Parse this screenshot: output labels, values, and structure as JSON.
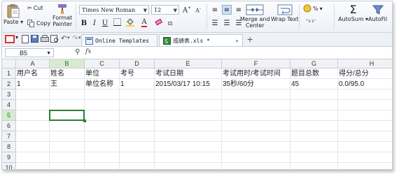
{
  "ribbon": {
    "paste": "Paste",
    "cut": "Cut",
    "copy": "Copy",
    "format_painter": [
      "Format",
      "Painter"
    ],
    "font_name": "Times New Roman",
    "font_size": "12",
    "merge_center": [
      "Merge and",
      "Center"
    ],
    "wrap_text": "Wrap Text",
    "percent": "%",
    "autosum": "AutoSum",
    "autofilter": "AutoFil"
  },
  "tabs": [
    {
      "label": "Online Templates",
      "active": false
    },
    {
      "label": "成绩表.xls *",
      "active": true
    }
  ],
  "formula_bar": {
    "name_box": "B5",
    "fx": "fx",
    "value": ""
  },
  "sheet": {
    "columns": [
      "A",
      "B",
      "C",
      "D",
      "E",
      "F",
      "G",
      "H"
    ],
    "rows": [
      "1",
      "2",
      "3",
      "4",
      "5",
      "6",
      "7",
      "8",
      "9",
      "10"
    ],
    "selected_cell": "B5",
    "data": [
      [
        "用户名",
        "姓名",
        "单位",
        "考号",
        "考试日期",
        "考试用时/考试时间",
        "题目总数",
        "得分/总分"
      ],
      [
        "1",
        "王",
        "单位名称",
        "1",
        "2015/03/17 10:15",
        "35秒/60分",
        "45",
        "0.0/95.0"
      ]
    ]
  }
}
